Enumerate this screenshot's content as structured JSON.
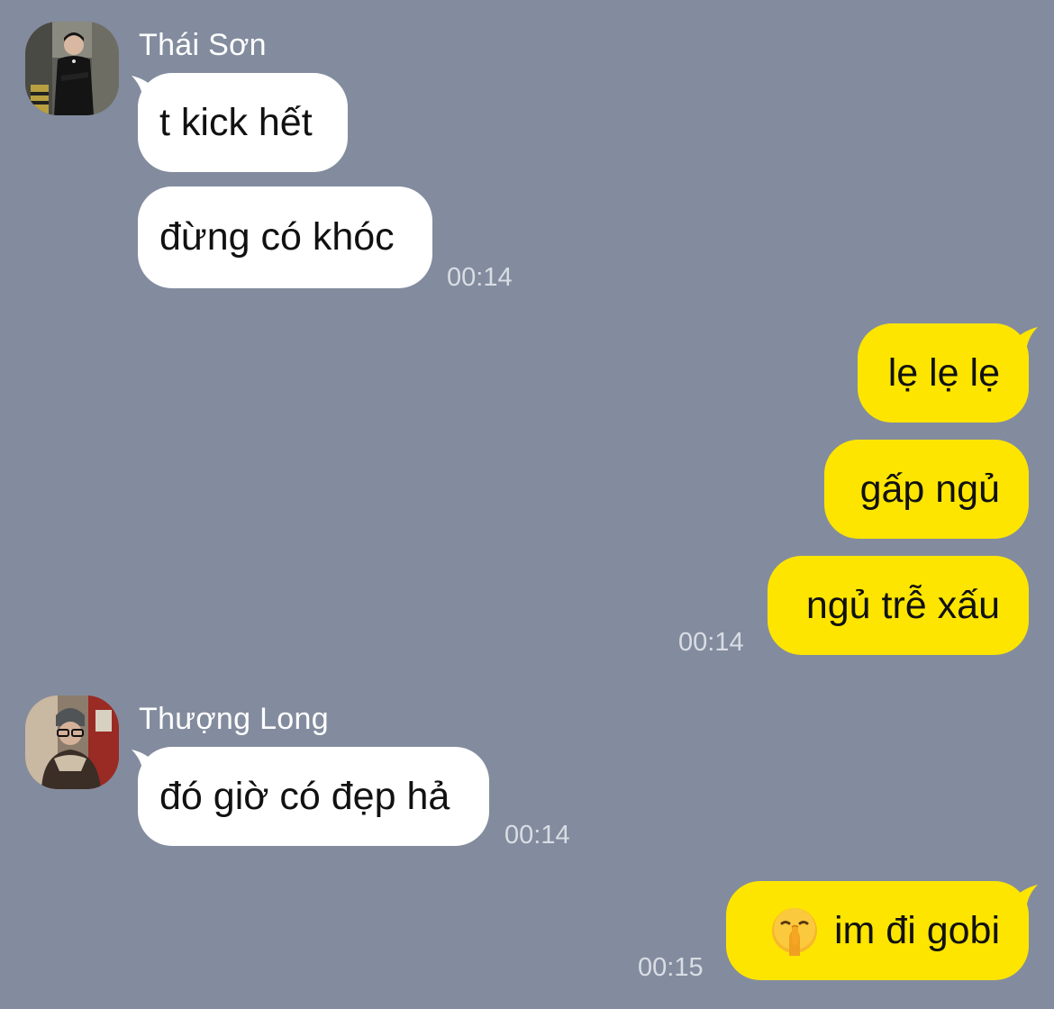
{
  "colors": {
    "background": "#838c9e",
    "incoming_bubble": "#ffffff",
    "outgoing_bubble": "#fee500",
    "timestamp": "#d9dde4"
  },
  "messages": {
    "group1": {
      "sender": "Thái Sơn",
      "avatar_icon": "profile-photo-icon",
      "texts": [
        "t kick hết",
        "đừng có khóc"
      ],
      "time": "00:14"
    },
    "group2": {
      "texts": [
        "lẹ lẹ lẹ",
        "gấp ngủ",
        "ngủ trễ xấu"
      ],
      "time": "00:14"
    },
    "group3": {
      "sender": "Thượng Long",
      "avatar_icon": "profile-photo-icon",
      "texts": [
        "đó giờ có đẹp hả"
      ],
      "time": "00:14"
    },
    "group4": {
      "emoji_icon": "shushing-face-emoji-icon",
      "texts": [
        "im đi gobi"
      ],
      "time": "00:15"
    }
  }
}
